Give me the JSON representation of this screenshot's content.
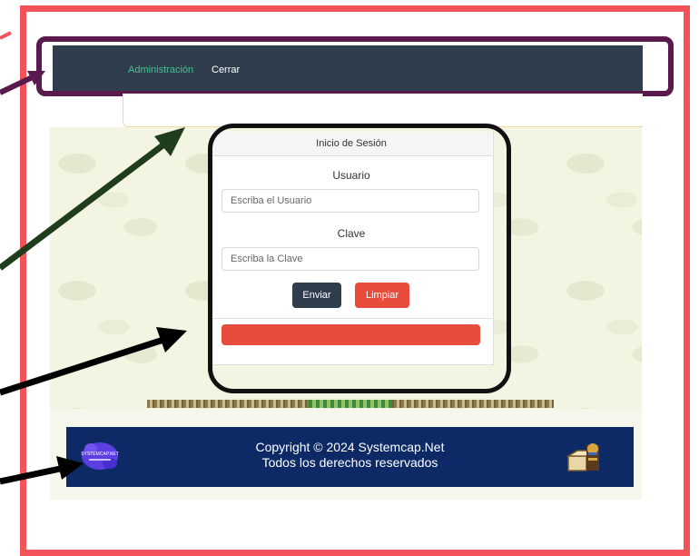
{
  "nav": {
    "items": [
      {
        "label": "Administración",
        "color": "#3fc490"
      },
      {
        "label": "Cerrar",
        "color": "#ffffff"
      }
    ],
    "background": "#2f3e4d"
  },
  "login": {
    "header": "Inicio de Sesión",
    "user_label": "Usuario",
    "user_placeholder": "Escriba el Usuario",
    "pass_label": "Clave",
    "pass_placeholder": "Escriba la Clave",
    "submit_label": "Enviar",
    "clear_label": "Limpiar"
  },
  "footer": {
    "line1": "Copyright © 2024 Systemcap.Net",
    "line2": "Todos los derechos reservados",
    "logo_text": "SYSTEMCAP.NET",
    "background": "#0d2a66"
  },
  "colors": {
    "frame_red": "#f25258",
    "frame_purple": "#5a1a4d",
    "arrow_green": "#1f3d1c",
    "arrow_black": "#000000",
    "accent_red": "#e74c3c"
  },
  "icons": {
    "footer_logo": "systemcap-logo-icon",
    "footer_right": "pharaoh-box-icon"
  }
}
